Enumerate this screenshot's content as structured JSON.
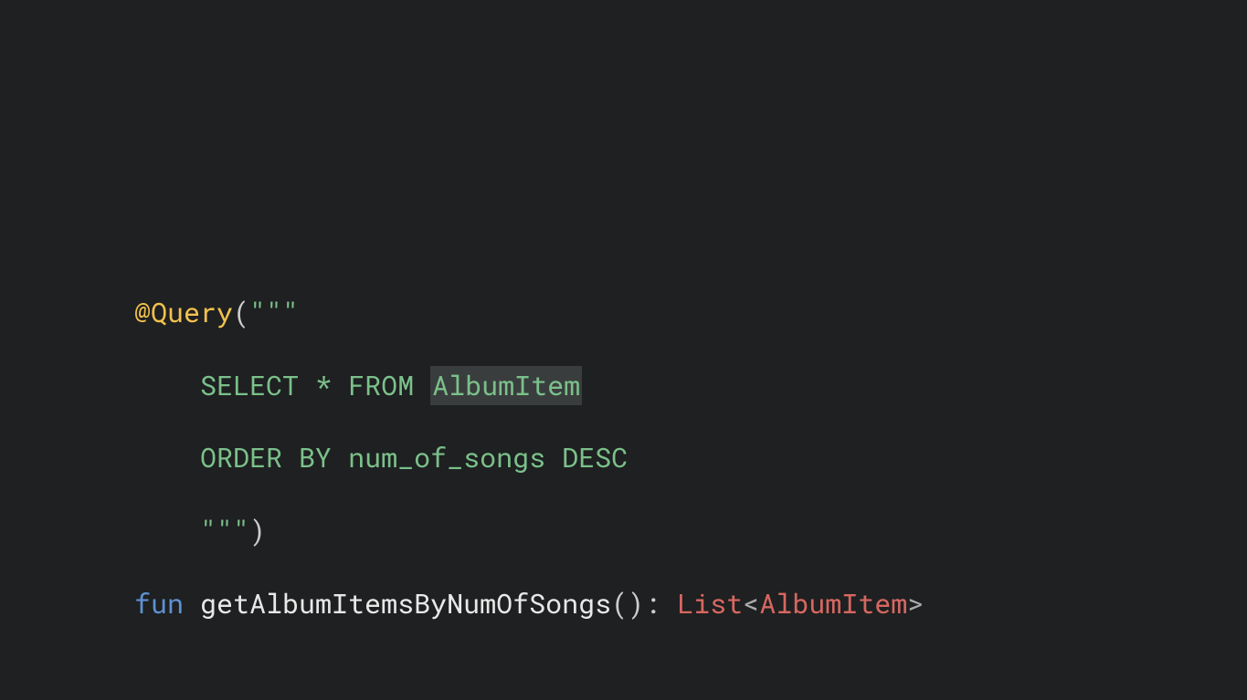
{
  "code": {
    "line1": {
      "annotation": "@Query",
      "open_paren": "(",
      "triple_quote": "\"\"\""
    },
    "line2": {
      "indent": "    ",
      "select": "SELECT",
      "space1": " ",
      "star": "*",
      "space2": " ",
      "from": "FROM",
      "space3": " ",
      "table": "AlbumItem"
    },
    "line3": {
      "indent": "    ",
      "order_by": "ORDER BY",
      "space1": " ",
      "column": "num_of_songs",
      "space2": " ",
      "desc": "DESC"
    },
    "line4": {
      "indent": "    ",
      "triple_quote": "\"\"\"",
      "close_paren": ")"
    },
    "line5": {
      "fun_keyword": "fun",
      "space1": " ",
      "function_name": "getAlbumItemsByNumOfSongs",
      "parens": "()",
      "colon": ":",
      "space2": " ",
      "return_type": "List",
      "open_angle": "<",
      "generic_type": "AlbumItem",
      "close_angle": ">"
    }
  }
}
